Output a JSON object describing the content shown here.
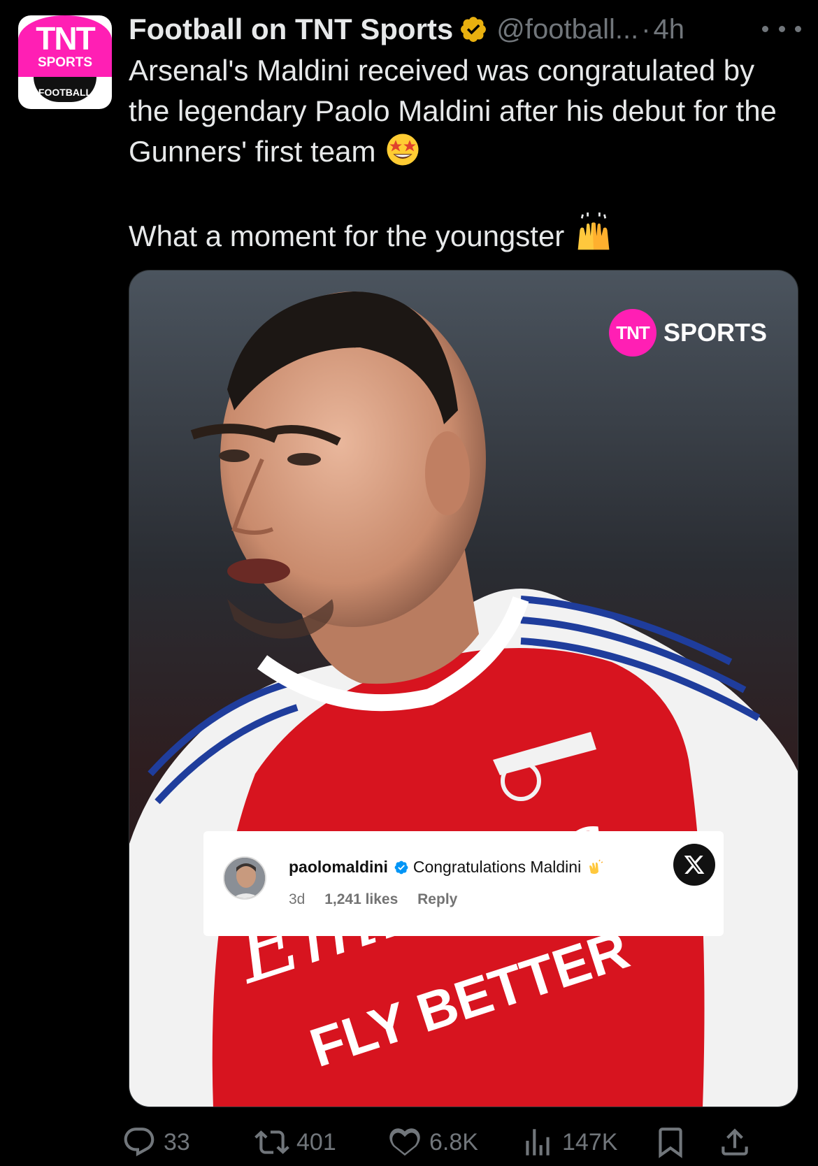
{
  "author": {
    "display_name": "Football on TNT Sports",
    "handle": "@football...",
    "timestamp": "4h",
    "separator": "·",
    "avatar_text": {
      "logo": "TNT",
      "line1": "SPORTS",
      "line2": "FOOTBALL"
    }
  },
  "tweet": {
    "paragraph1": "Arsenal's Maldini received was congratulated by the legendary Paolo Maldini after his debut for the Gunners' first team",
    "paragraph2": "What a moment for the youngster"
  },
  "media": {
    "watermark": {
      "logo": "TNT",
      "word": "SPORTS"
    },
    "comment": {
      "username": "paolomaldini",
      "text": "Congratulations Maldini",
      "age": "3d",
      "likes": "1,241 likes",
      "reply": "Reply"
    },
    "shirt_sponsor": [
      "Emirates",
      "FLY BETTER"
    ]
  },
  "actions": {
    "replies": "33",
    "reposts": "401",
    "likes": "6.8K",
    "views": "147K"
  },
  "colors": {
    "background": "#000000",
    "text": "#e7e9ea",
    "muted": "#71767b",
    "brand": "#ff1fb4",
    "verified": "#f4b400"
  }
}
